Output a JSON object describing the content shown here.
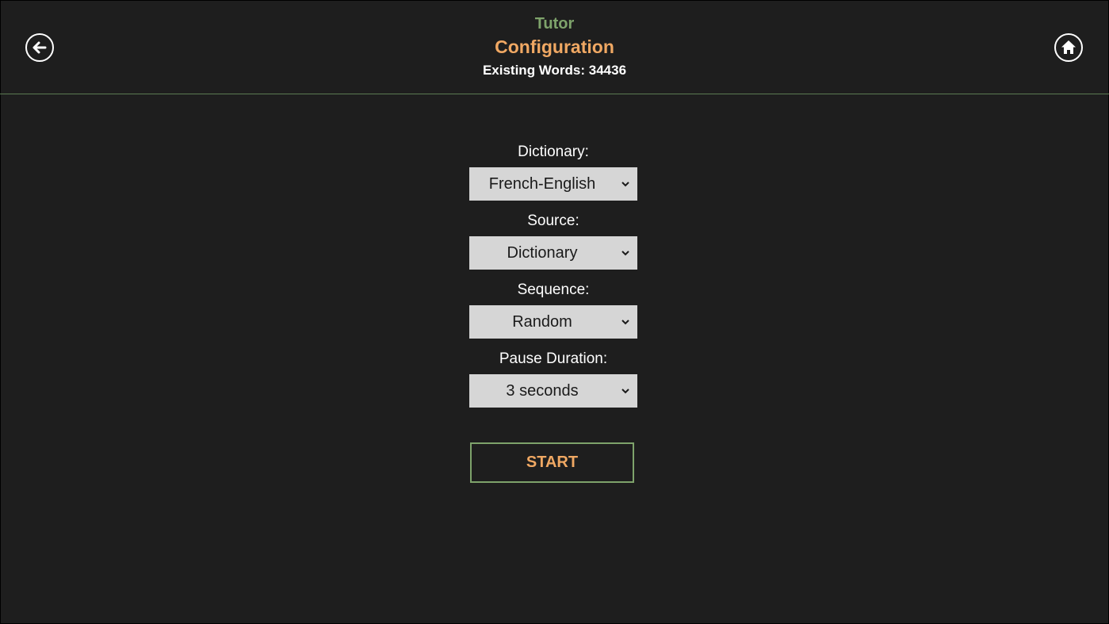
{
  "header": {
    "app_title": "Tutor",
    "page_title": "Configuration",
    "existing_words": "Existing Words: 34436",
    "back_icon": "arrow-left-circle-icon",
    "home_icon": "home-circle-icon"
  },
  "form": {
    "dictionary": {
      "label": "Dictionary:",
      "value": "French-English"
    },
    "source": {
      "label": "Source:",
      "value": "Dictionary"
    },
    "sequence": {
      "label": "Sequence:",
      "value": "Random"
    },
    "pause_duration": {
      "label": "Pause Duration:",
      "value": "3 seconds"
    }
  },
  "actions": {
    "start_label": "START"
  },
  "colors": {
    "background": "#1e1e1e",
    "accent_green": "#7ea36b",
    "accent_orange": "#f0a863",
    "select_bg": "#d6d6d6"
  }
}
